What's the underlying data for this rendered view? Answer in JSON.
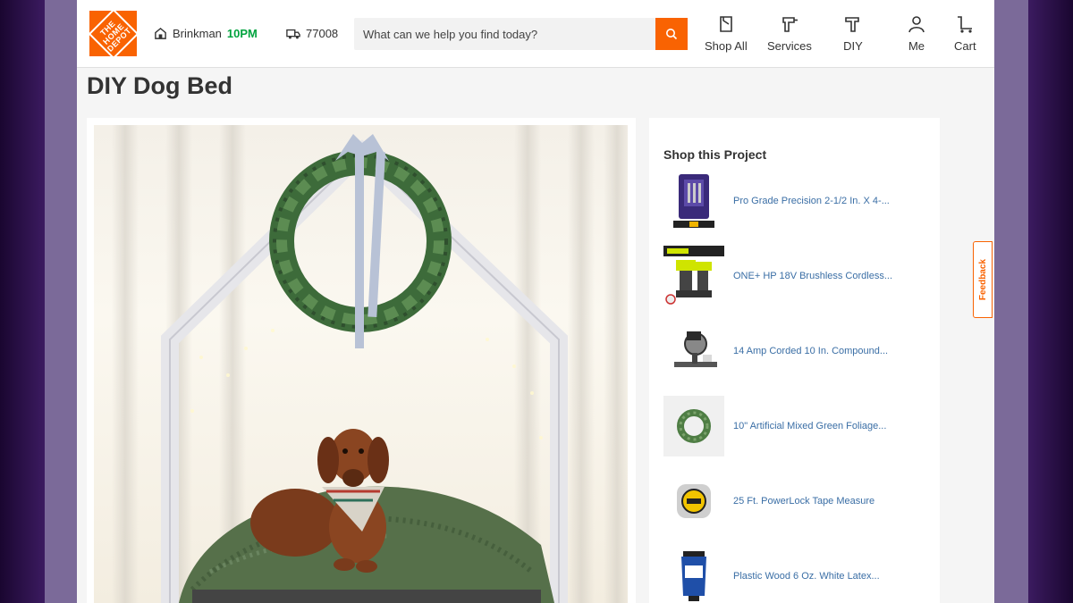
{
  "brand": {
    "logo_text": "THE HOME DEPOT",
    "color": "#f96302"
  },
  "header": {
    "store_name": "Brinkman",
    "store_hours": "10PM",
    "zip": "77008",
    "search_placeholder": "What can we help you find today?",
    "nav": [
      {
        "label": "Shop All",
        "icon": "shop-all-icon"
      },
      {
        "label": "Services",
        "icon": "services-drill-icon"
      },
      {
        "label": "DIY",
        "icon": "hammer-icon"
      },
      {
        "label": "Me",
        "icon": "user-icon"
      },
      {
        "label": "Cart",
        "icon": "cart-icon"
      }
    ]
  },
  "main": {
    "title": "DIY Dog Bed",
    "image_alt": "Dachshund in a white wooden house-frame dog bed with wreath"
  },
  "aside": {
    "title": "Shop this Project",
    "products": [
      {
        "name": "Pro Grade Precision 2-1/2 In. X 4-...",
        "icon": "drill-bit-set-icon"
      },
      {
        "name": "ONE+ HP 18V Brushless Cordless...",
        "icon": "drill-kit-icon"
      },
      {
        "name": "14 Amp Corded 10 In. Compound...",
        "icon": "miter-saw-icon"
      },
      {
        "name": "10\" Artificial Mixed Green Foliage...",
        "icon": "wreath-icon"
      },
      {
        "name": "25 Ft. PowerLock Tape Measure",
        "icon": "tape-measure-icon"
      },
      {
        "name": "Plastic Wood 6 Oz. White Latex...",
        "icon": "wood-filler-tube-icon"
      }
    ]
  },
  "feedback_label": "Feedback"
}
